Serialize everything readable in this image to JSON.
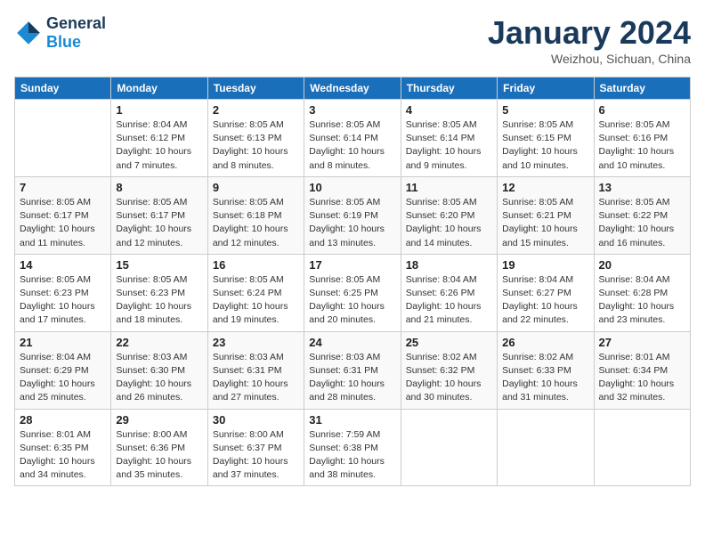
{
  "logo": {
    "line1": "General",
    "line2": "Blue"
  },
  "title": "January 2024",
  "location": "Weizhou, Sichuan, China",
  "headers": [
    "Sunday",
    "Monday",
    "Tuesday",
    "Wednesday",
    "Thursday",
    "Friday",
    "Saturday"
  ],
  "weeks": [
    [
      {
        "day": "",
        "info": ""
      },
      {
        "day": "1",
        "info": "Sunrise: 8:04 AM\nSunset: 6:12 PM\nDaylight: 10 hours\nand 7 minutes."
      },
      {
        "day": "2",
        "info": "Sunrise: 8:05 AM\nSunset: 6:13 PM\nDaylight: 10 hours\nand 8 minutes."
      },
      {
        "day": "3",
        "info": "Sunrise: 8:05 AM\nSunset: 6:14 PM\nDaylight: 10 hours\nand 8 minutes."
      },
      {
        "day": "4",
        "info": "Sunrise: 8:05 AM\nSunset: 6:14 PM\nDaylight: 10 hours\nand 9 minutes."
      },
      {
        "day": "5",
        "info": "Sunrise: 8:05 AM\nSunset: 6:15 PM\nDaylight: 10 hours\nand 10 minutes."
      },
      {
        "day": "6",
        "info": "Sunrise: 8:05 AM\nSunset: 6:16 PM\nDaylight: 10 hours\nand 10 minutes."
      }
    ],
    [
      {
        "day": "7",
        "info": "Sunrise: 8:05 AM\nSunset: 6:17 PM\nDaylight: 10 hours\nand 11 minutes."
      },
      {
        "day": "8",
        "info": "Sunrise: 8:05 AM\nSunset: 6:17 PM\nDaylight: 10 hours\nand 12 minutes."
      },
      {
        "day": "9",
        "info": "Sunrise: 8:05 AM\nSunset: 6:18 PM\nDaylight: 10 hours\nand 12 minutes."
      },
      {
        "day": "10",
        "info": "Sunrise: 8:05 AM\nSunset: 6:19 PM\nDaylight: 10 hours\nand 13 minutes."
      },
      {
        "day": "11",
        "info": "Sunrise: 8:05 AM\nSunset: 6:20 PM\nDaylight: 10 hours\nand 14 minutes."
      },
      {
        "day": "12",
        "info": "Sunrise: 8:05 AM\nSunset: 6:21 PM\nDaylight: 10 hours\nand 15 minutes."
      },
      {
        "day": "13",
        "info": "Sunrise: 8:05 AM\nSunset: 6:22 PM\nDaylight: 10 hours\nand 16 minutes."
      }
    ],
    [
      {
        "day": "14",
        "info": "Sunrise: 8:05 AM\nSunset: 6:23 PM\nDaylight: 10 hours\nand 17 minutes."
      },
      {
        "day": "15",
        "info": "Sunrise: 8:05 AM\nSunset: 6:23 PM\nDaylight: 10 hours\nand 18 minutes."
      },
      {
        "day": "16",
        "info": "Sunrise: 8:05 AM\nSunset: 6:24 PM\nDaylight: 10 hours\nand 19 minutes."
      },
      {
        "day": "17",
        "info": "Sunrise: 8:05 AM\nSunset: 6:25 PM\nDaylight: 10 hours\nand 20 minutes."
      },
      {
        "day": "18",
        "info": "Sunrise: 8:04 AM\nSunset: 6:26 PM\nDaylight: 10 hours\nand 21 minutes."
      },
      {
        "day": "19",
        "info": "Sunrise: 8:04 AM\nSunset: 6:27 PM\nDaylight: 10 hours\nand 22 minutes."
      },
      {
        "day": "20",
        "info": "Sunrise: 8:04 AM\nSunset: 6:28 PM\nDaylight: 10 hours\nand 23 minutes."
      }
    ],
    [
      {
        "day": "21",
        "info": "Sunrise: 8:04 AM\nSunset: 6:29 PM\nDaylight: 10 hours\nand 25 minutes."
      },
      {
        "day": "22",
        "info": "Sunrise: 8:03 AM\nSunset: 6:30 PM\nDaylight: 10 hours\nand 26 minutes."
      },
      {
        "day": "23",
        "info": "Sunrise: 8:03 AM\nSunset: 6:31 PM\nDaylight: 10 hours\nand 27 minutes."
      },
      {
        "day": "24",
        "info": "Sunrise: 8:03 AM\nSunset: 6:31 PM\nDaylight: 10 hours\nand 28 minutes."
      },
      {
        "day": "25",
        "info": "Sunrise: 8:02 AM\nSunset: 6:32 PM\nDaylight: 10 hours\nand 30 minutes."
      },
      {
        "day": "26",
        "info": "Sunrise: 8:02 AM\nSunset: 6:33 PM\nDaylight: 10 hours\nand 31 minutes."
      },
      {
        "day": "27",
        "info": "Sunrise: 8:01 AM\nSunset: 6:34 PM\nDaylight: 10 hours\nand 32 minutes."
      }
    ],
    [
      {
        "day": "28",
        "info": "Sunrise: 8:01 AM\nSunset: 6:35 PM\nDaylight: 10 hours\nand 34 minutes."
      },
      {
        "day": "29",
        "info": "Sunrise: 8:00 AM\nSunset: 6:36 PM\nDaylight: 10 hours\nand 35 minutes."
      },
      {
        "day": "30",
        "info": "Sunrise: 8:00 AM\nSunset: 6:37 PM\nDaylight: 10 hours\nand 37 minutes."
      },
      {
        "day": "31",
        "info": "Sunrise: 7:59 AM\nSunset: 6:38 PM\nDaylight: 10 hours\nand 38 minutes."
      },
      {
        "day": "",
        "info": ""
      },
      {
        "day": "",
        "info": ""
      },
      {
        "day": "",
        "info": ""
      }
    ]
  ]
}
